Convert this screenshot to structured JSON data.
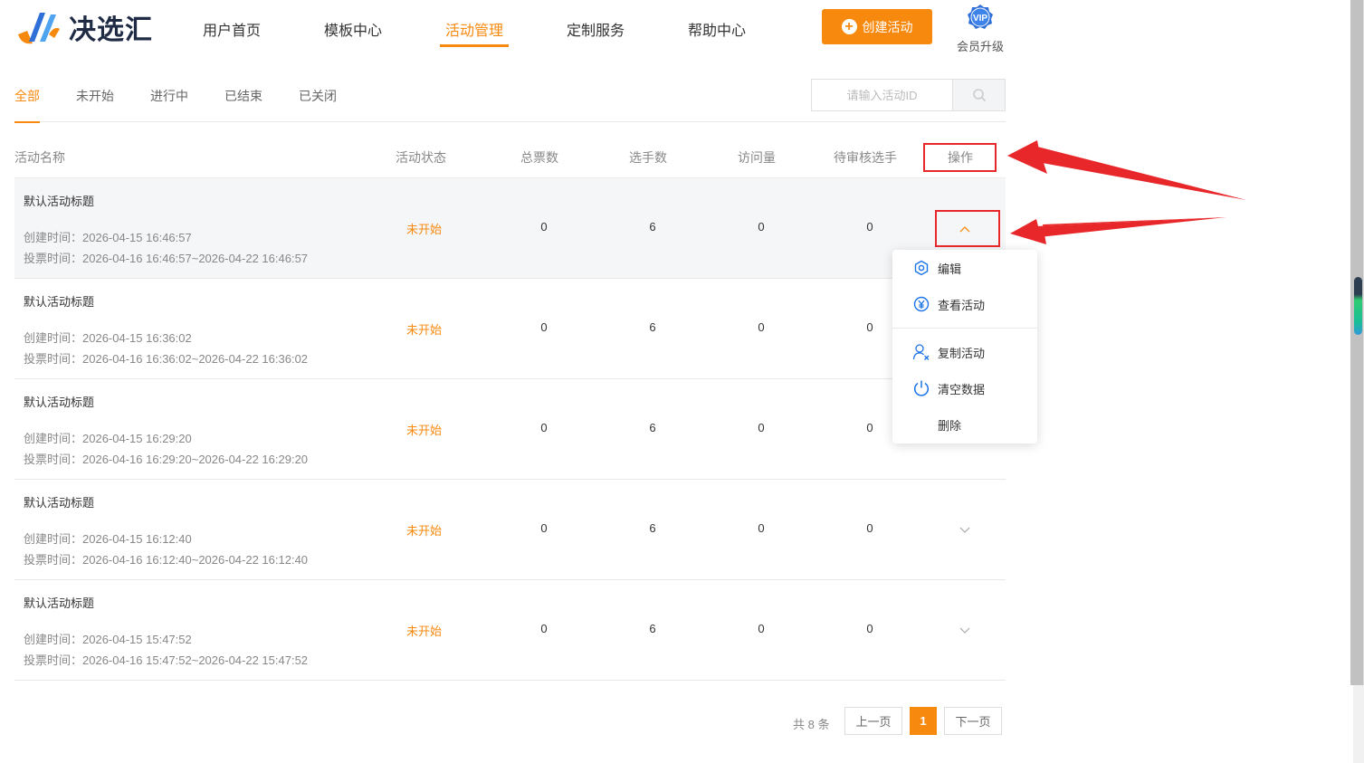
{
  "brand": {
    "name": "决选汇"
  },
  "nav": {
    "items": [
      {
        "label": "用户首页",
        "active": false
      },
      {
        "label": "模板中心",
        "active": false
      },
      {
        "label": "活动管理",
        "active": true
      },
      {
        "label": "定制服务",
        "active": false
      },
      {
        "label": "帮助中心",
        "active": false
      }
    ],
    "create_label": "创建活动",
    "vip_badge": "VIP",
    "vip_label": "会员升级"
  },
  "filters": {
    "tabs": [
      "全部",
      "未开始",
      "进行中",
      "已结束",
      "已关闭"
    ],
    "active": "全部",
    "search_placeholder": "请输入活动ID"
  },
  "table": {
    "headers": [
      "活动名称",
      "活动状态",
      "总票数",
      "选手数",
      "访问量",
      "待审核选手",
      "操作"
    ],
    "created_prefix": "创建时间：",
    "vote_prefix": "投票时间：",
    "rows": [
      {
        "title": "默认活动标题",
        "created": "2026-04-15 16:46:57",
        "vote_time": "2026-04-16 16:46:57~2026-04-22 16:46:57",
        "status": "未开始",
        "votes": "0",
        "players": "6",
        "visits": "0",
        "pending": "0",
        "expanded": true
      },
      {
        "title": "默认活动标题",
        "created": "2026-04-15 16:36:02",
        "vote_time": "2026-04-16 16:36:02~2026-04-22 16:36:02",
        "status": "未开始",
        "votes": "0",
        "players": "6",
        "visits": "0",
        "pending": "0",
        "expanded": false
      },
      {
        "title": "默认活动标题",
        "created": "2026-04-15 16:29:20",
        "vote_time": "2026-04-16 16:29:20~2026-04-22 16:29:20",
        "status": "未开始",
        "votes": "0",
        "players": "6",
        "visits": "0",
        "pending": "0",
        "expanded": false
      },
      {
        "title": "默认活动标题",
        "created": "2026-04-15 16:12:40",
        "vote_time": "2026-04-16 16:12:40~2026-04-22 16:12:40",
        "status": "未开始",
        "votes": "0",
        "players": "6",
        "visits": "0",
        "pending": "0",
        "expanded": false
      },
      {
        "title": "默认活动标题",
        "created": "2026-04-15 15:47:52",
        "vote_time": "2026-04-16 15:47:52~2026-04-22 15:47:52",
        "status": "未开始",
        "votes": "0",
        "players": "6",
        "visits": "0",
        "pending": "0",
        "expanded": false
      }
    ]
  },
  "dropdown": {
    "items": [
      {
        "label": "编辑",
        "icon": "settings-icon"
      },
      {
        "label": "查看活动",
        "icon": "yen-icon"
      },
      {
        "label": "复制活动",
        "icon": "user-remove-icon"
      },
      {
        "label": "清空数据",
        "icon": "power-icon"
      },
      {
        "label": "删除",
        "icon": ""
      }
    ]
  },
  "pagination": {
    "total_label": "共 8 条",
    "prev_label": "上一页",
    "current_page": "1",
    "next_label": "下一页"
  },
  "colors": {
    "accent": "#f7890f",
    "annotation": "#e8272a",
    "icon_blue": "#1a73e8"
  }
}
